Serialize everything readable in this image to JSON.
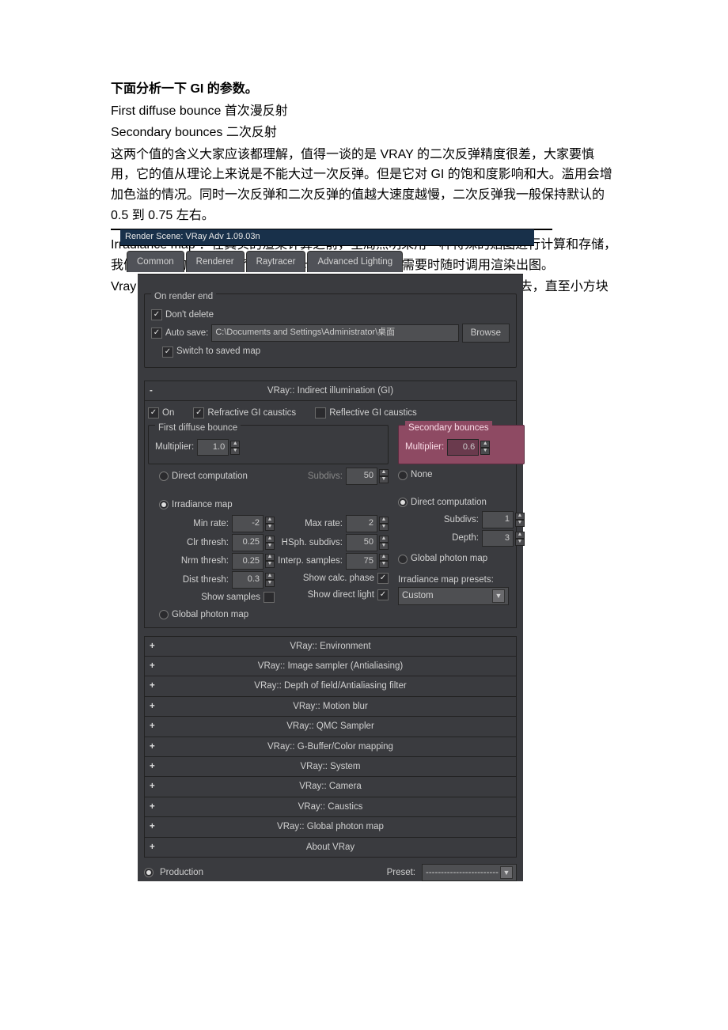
{
  "doc": {
    "header": "下面分析一下 GI 的参数。",
    "line1": "First diffuse bounce  首次漫反射",
    "line2": "Secondary bounces  二次反射",
    "para1": "这两个值的含义大家应该都理解，值得一谈的是 VRAY 的二次反弹精度很差，大家要慎用，它的值从理论上来说是不能大过一次反弹。但是它对 GI 的饱和度影响和大。滥用会增加色溢的情况。同时一次反弹和二次反弹的值越大速度越慢，二次反弹我一般保持默认的 0.5 到 0.75 左右。",
    "para2": "Irradiance map  ：在真实的渲染计算之前，全局照明采用一种特殊的贴图进行计算和存储，我们开始做的也就是为了保存这个计算的结果，并在需要时随时调用渲染出图。",
    "para3": "Vray 将屏幕细分成一个个小方块, 大小由  min rate 确定,计算时逐渐细分下去，直至小方块"
  },
  "ui": {
    "window_title": "Render Scene: VRay Adv 1.09.03n",
    "tabs": [
      "Common",
      "Renderer",
      "Raytracer",
      "Advanced Lighting"
    ],
    "on_render_end": {
      "title": "On render end",
      "dont_delete": "Don't delete",
      "auto_save": "Auto save:",
      "path": "C:\\Documents and Settings\\Administrator\\桌面",
      "browse": "Browse",
      "switch": "Switch to saved map"
    },
    "gi": {
      "rollup": "VRay:: Indirect illumination (GI)",
      "on": "On",
      "refractive": "Refractive GI caustics",
      "reflective": "Reflective GI caustics",
      "first": {
        "title": "First diffuse bounce",
        "multiplier_label": "Multiplier:",
        "multiplier": "1.0"
      },
      "second": {
        "title": "Secondary bounces",
        "multiplier_label": "Multiplier:",
        "multiplier": "0.6"
      },
      "direct_comp": "Direct computation",
      "subdivs_label": "Subdivs:",
      "direct_subdivs": "50",
      "none": "None",
      "irr": "Irradiance map",
      "min_rate_label": "Min rate:",
      "min_rate": "-2",
      "max_rate_label": "Max rate:",
      "max_rate": "2",
      "clr_thresh_label": "Clr thresh:",
      "clr_thresh": "0.25",
      "hsph_label": "HSph. subdivs:",
      "hsph": "50",
      "nrm_thresh_label": "Nrm thresh:",
      "nrm_thresh": "0.25",
      "interp_label": "Interp. samples:",
      "interp": "75",
      "dist_thresh_label": "Dist thresh:",
      "dist_thresh": "0.3",
      "show_calc": "Show calc. phase",
      "show_samples": "Show samples",
      "show_direct": "Show direct light",
      "global_photon": "Global photon map",
      "sec_direct_comp": "Direct computation",
      "sec_subdivs_label": "Subdivs:",
      "sec_subdivs": "1",
      "sec_depth_label": "Depth:",
      "sec_depth": "3",
      "sec_global_photon": "Global photon map",
      "presets_label": "Irradiance map presets:",
      "presets_value": "Custom"
    },
    "rollups": [
      "VRay:: Environment",
      "VRay:: Image sampler (Antialiasing)",
      "VRay:: Depth of field/Antialiasing filter",
      "VRay:: Motion blur",
      "VRay:: QMC Sampler",
      "VRay:: G-Buffer/Color mapping",
      "VRay:: System",
      "VRay:: Camera",
      "VRay:: Caustics",
      "VRay:: Global photon map",
      "About VRay"
    ],
    "footer": {
      "production": "Production",
      "preset_label": "Preset:",
      "preset_value": "------------------------"
    }
  }
}
